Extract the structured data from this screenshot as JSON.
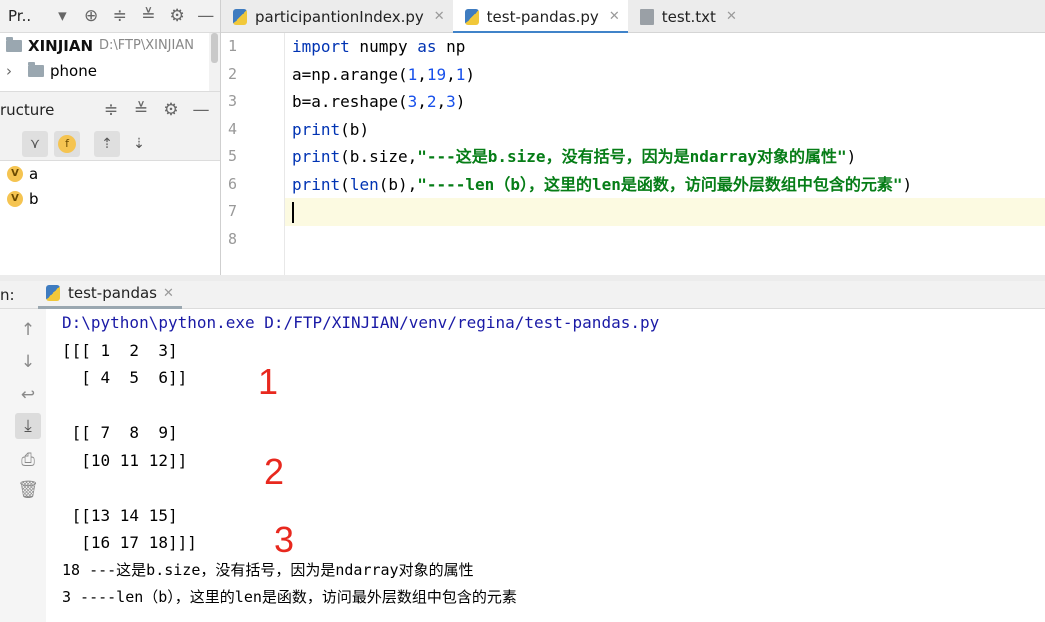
{
  "project_panel": {
    "title": "Pr..",
    "root": {
      "name": "XINJIAN",
      "path": "D:\\FTP\\XINJIAN"
    },
    "items": [
      {
        "label": "phone"
      }
    ]
  },
  "structure_panel": {
    "title": "ructure",
    "f_badge": "f",
    "vars": [
      {
        "badge": "V",
        "name": "a"
      },
      {
        "badge": "V",
        "name": "b"
      }
    ]
  },
  "tabs": [
    {
      "label": "participantionIndex.py",
      "active": false
    },
    {
      "label": "test-pandas.py",
      "active": true
    },
    {
      "label": "test.txt",
      "active": false
    }
  ],
  "editor": {
    "line_numbers": [
      "1",
      "2",
      "3",
      "4",
      "5",
      "6",
      "7",
      "8"
    ],
    "current_line": 7
  },
  "run_panel": {
    "label": "n:",
    "tab_label": "test-pandas",
    "command": "D:\\python\\python.exe D:/FTP/XINJIAN/venv/regina/test-pandas.py",
    "output": [
      "[[[ 1  2  3]",
      "  [ 4  5  6]]",
      "",
      " [[ 7  8  9]",
      "  [10 11 12]]",
      "",
      " [[13 14 15]",
      "  [16 17 18]]]",
      "18 ---这是b.size，没有括号，因为是ndarray对象的属性",
      "3 ----len（b），这里的len是函数，访问最外层数组中包含的元素"
    ],
    "annotations": [
      "1",
      "2",
      "3"
    ]
  },
  "icons": {
    "close": "×",
    "collapse": "minus",
    "settings": "gear",
    "scroll_up": "up-arrow",
    "scroll_down": "down-arrow",
    "soft_wrap": "wrap",
    "scroll_end": "scroll-to-end",
    "print": "printer",
    "clear": "trash"
  }
}
